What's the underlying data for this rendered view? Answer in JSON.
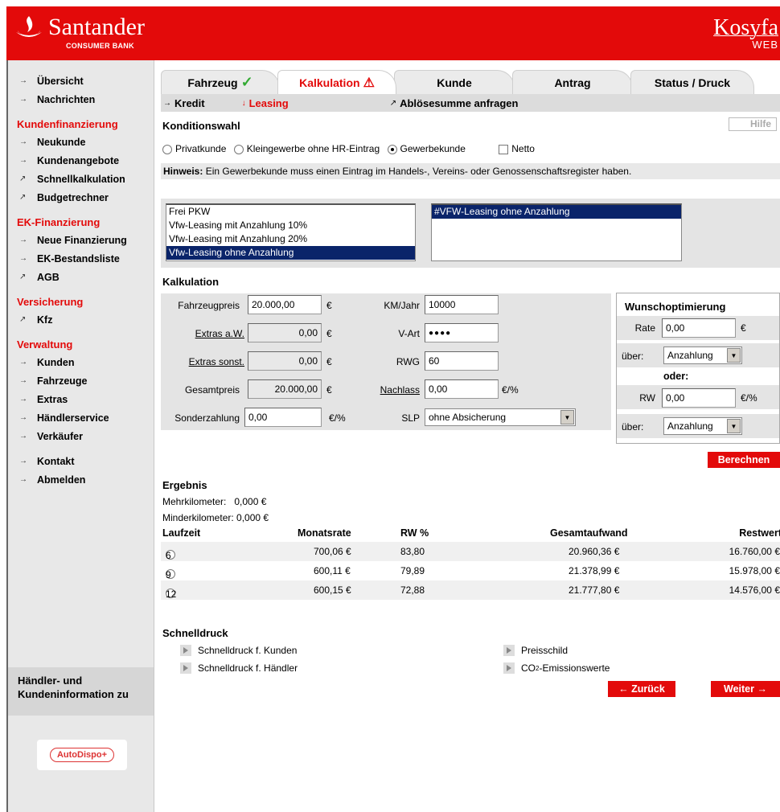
{
  "header": {
    "brand": "Santander",
    "brand_sub": "CONSUMER BANK",
    "app_name": "Kosyfa",
    "app_sub": "WEB"
  },
  "sidebar": {
    "top_items": [
      {
        "label": "Übersicht"
      },
      {
        "label": "Nachrichten"
      }
    ],
    "groups": [
      {
        "title": "Kundenfinanzierung",
        "items": [
          {
            "label": "Neukunde",
            "arrow": "→"
          },
          {
            "label": "Kundenangebote",
            "arrow": "→"
          },
          {
            "label": "Schnellkalkulation",
            "arrow": "↗"
          },
          {
            "label": "Budgetrechner",
            "arrow": "↗"
          }
        ]
      },
      {
        "title": "EK-Finanzierung",
        "items": [
          {
            "label": "Neue Finanzierung",
            "arrow": "→"
          },
          {
            "label": "EK-Bestandsliste",
            "arrow": "→"
          },
          {
            "label": "AGB",
            "arrow": "↗"
          }
        ]
      },
      {
        "title": "Versicherung",
        "items": [
          {
            "label": "Kfz",
            "arrow": "↗"
          }
        ]
      },
      {
        "title": "Verwaltung",
        "items": [
          {
            "label": "Kunden",
            "arrow": "→"
          },
          {
            "label": "Fahrzeuge",
            "arrow": "→"
          },
          {
            "label": "Extras",
            "arrow": "→"
          },
          {
            "label": "Händlerservice",
            "arrow": "→"
          },
          {
            "label": "Verkäufer",
            "arrow": "→"
          }
        ]
      }
    ],
    "bottom_items": [
      {
        "label": "Kontakt"
      },
      {
        "label": "Abmelden"
      }
    ],
    "info_label": "Händler- und Kundeninformation zu",
    "autodispo_label": "AutoDispo+"
  },
  "tabs": [
    {
      "label": "Fahrzeug",
      "state": "done"
    },
    {
      "label": "Kalkulation",
      "state": "warning"
    },
    {
      "label": "Kunde"
    },
    {
      "label": "Antrag"
    },
    {
      "label": "Status / Druck"
    }
  ],
  "subtabs": [
    {
      "label": "Kredit",
      "arrow": "→"
    },
    {
      "label": "Leasing",
      "arrow": "↓"
    },
    {
      "label": "Ablösesumme anfragen",
      "arrow": "↗"
    }
  ],
  "konditionswahl": {
    "title": "Konditionswahl",
    "help": "Hilfe",
    "options": [
      "Privatkunde",
      "Kleingewerbe ohne HR-Eintrag",
      "Gewerbekunde"
    ],
    "selected": "Gewerbekunde",
    "netto_label": "Netto",
    "hinweis_label": "Hinweis:",
    "hinweis_text": "Ein Gewerbekunde muss einen Eintrag im Handels-, Vereins- oder Genossenschaftsregister haben."
  },
  "product_list": [
    "Frei PKW",
    "Vfw-Leasing mit Anzahlung 10%",
    "Vfw-Leasing mit Anzahlung 20%",
    "Vfw-Leasing ohne Anzahlung"
  ],
  "product_selected": "Vfw-Leasing ohne Anzahlung",
  "variant_list": [
    "#VFW-Leasing ohne Anzahlung"
  ],
  "kalkulation": {
    "title": "Kalkulation",
    "fahrzeugpreis_label": "Fahrzeugpreis",
    "fahrzeugpreis": "20.000,00",
    "extras_aw_label": "Extras a.W.",
    "extras_aw": "0,00",
    "extras_sonst_label": "Extras sonst.",
    "extras_sonst": "0,00",
    "gesamtpreis_label": "Gesamtpreis",
    "gesamtpreis": "20.000,00",
    "sonderzahlung_label": "Sonderzahlung",
    "sonderzahlung": "0,00",
    "km_label": "KM/Jahr",
    "km": "10000",
    "vart_label": "V-Art",
    "vart": "●●●●",
    "rwg_label": "RWG",
    "rwg": "60",
    "nachlass_label": "Nachlass",
    "nachlass": "0,00",
    "slp_label": "SLP",
    "slp": "ohne Absicherung",
    "euro": "€",
    "euro_pct": "€/%"
  },
  "wunsch": {
    "title": "Wunschoptimierung",
    "rate_label": "Rate",
    "rate": "0,00",
    "ueber_label": "über:",
    "ueber1": "Anzahlung",
    "oder": "oder:",
    "rw_label": "RW",
    "rw": "0,00",
    "ueber2": "Anzahlung"
  },
  "berechnen_label": "Berechnen",
  "ergebnis": {
    "title": "Ergebnis",
    "mehrkm": "Mehrkilometer:   0,000 €",
    "minderkm": "Minderkilometer: 0,000 €",
    "headers": [
      "Laufzeit",
      "Monatsrate",
      "RW %",
      "Gesamtaufwand",
      "Restwert"
    ],
    "rows": [
      {
        "laufzeit": "6",
        "rate": "700,06 €",
        "rw": "83,80",
        "gesamt": "20.960,36 €",
        "restwert": "16.760,00 €"
      },
      {
        "laufzeit": "9",
        "rate": "600,11 €",
        "rw": "79,89",
        "gesamt": "21.378,99 €",
        "restwert": "15.978,00 €"
      },
      {
        "laufzeit": "12",
        "rate": "600,15 €",
        "rw": "72,88",
        "gesamt": "21.777,80 €",
        "restwert": "14.576,00 €"
      }
    ]
  },
  "schnelldruck": {
    "title": "Schnelldruck",
    "kunden": "Schnelldruck f. Kunden",
    "haendler": "Schnelldruck f. Händler",
    "preisschild": "Preisschild",
    "co2_prefix": "CO",
    "co2_sub": "2",
    "co2_suffix": "-Emissionswerte"
  },
  "zurueck_label": "← Zurück",
  "weiter_label": "Weiter →",
  "colors": {
    "brand_red": "#e30a0a",
    "selection": "#0a246a",
    "sidebar_bg": "#e8e8e8"
  }
}
